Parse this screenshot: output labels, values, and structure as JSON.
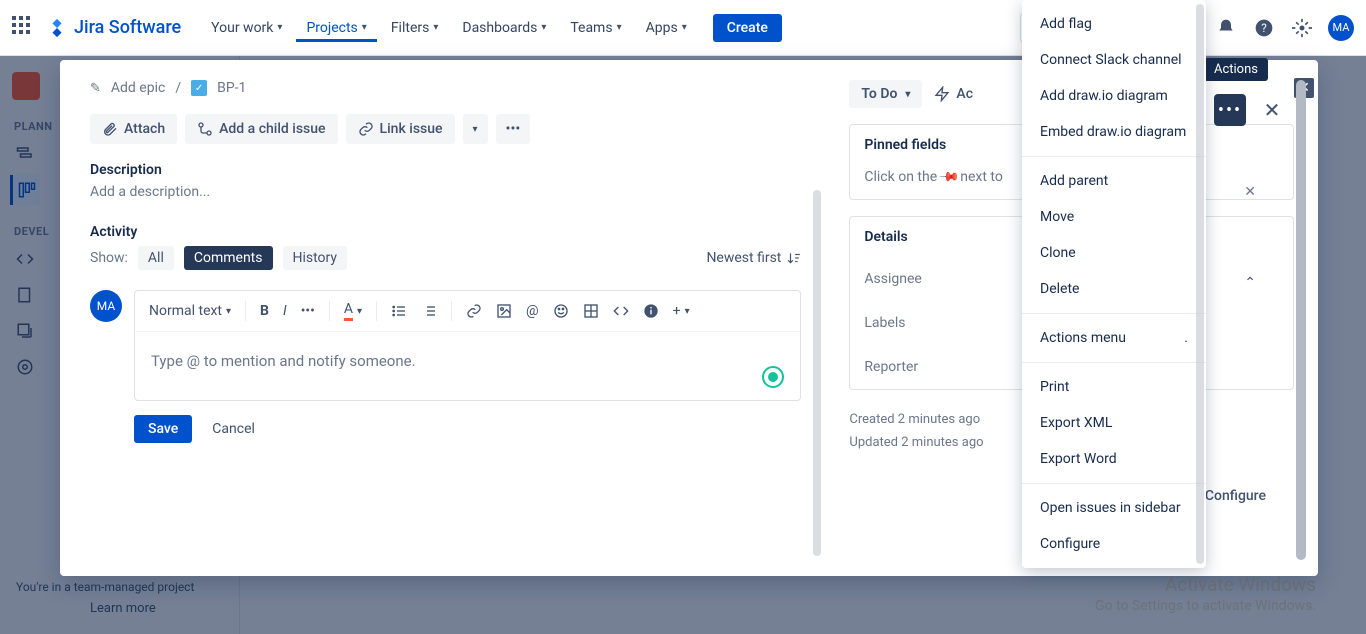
{
  "nav": {
    "logo": "Jira Software",
    "items": [
      "Your work",
      "Projects",
      "Filters",
      "Dashboards",
      "Teams",
      "Apps"
    ],
    "active": 1,
    "create": "Create",
    "avatar": "MA"
  },
  "sidebar": {
    "planning": "PLANN",
    "development": "DEVEL",
    "footer": "You're in a team-managed project",
    "learn": "Learn more"
  },
  "crumb": {
    "epic": "Add epic",
    "issue": "BP-1"
  },
  "actions": {
    "attach": "Attach",
    "child": "Add a child issue",
    "link": "Link issue"
  },
  "section": {
    "description": "Description",
    "desc_ph": "Add a description...",
    "activity": "Activity",
    "show": "Show:",
    "tabs": [
      "All",
      "Comments",
      "History"
    ],
    "newest": "Newest first"
  },
  "editor": {
    "style": "Normal text",
    "placeholder": "Type @ to mention and notify someone.",
    "avatar": "MA",
    "save": "Save",
    "cancel": "Cancel"
  },
  "side": {
    "status": "To Do",
    "ai": "Ac",
    "pinned": "Pinned fields",
    "pinned_body_pre": "Click on the",
    "pinned_body_post": "next to",
    "details": "Details",
    "assignee": "Assignee",
    "labels": "Labels",
    "reporter": "Reporter",
    "created": "Created 2 minutes ago",
    "updated": "Updated 2 minutes ago",
    "configure": "Configure"
  },
  "tooltip": "Actions",
  "menu": {
    "g1": [
      "Add flag",
      "Connect Slack channel",
      "Add draw.io diagram",
      "Embed draw.io diagram"
    ],
    "g2": [
      "Add parent",
      "Move",
      "Clone",
      "Delete"
    ],
    "label": "Actions menu",
    "dot": ".",
    "g3": [
      "Print",
      "Export XML",
      "Export Word"
    ],
    "g4": [
      "Open issues in sidebar",
      "Configure"
    ]
  },
  "watermark": {
    "title": "Activate Windows",
    "sub": "Go to Settings to activate Windows."
  }
}
